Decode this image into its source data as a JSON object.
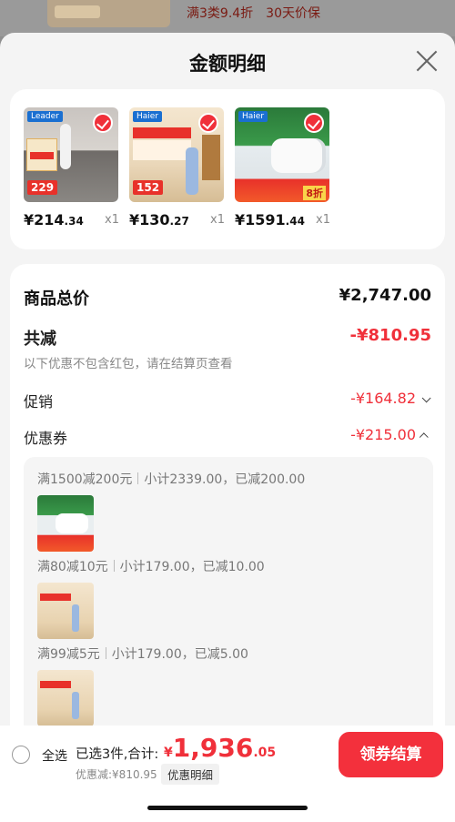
{
  "background": {
    "promo": [
      "满3类9.4折",
      "30天价保"
    ]
  },
  "sheet": {
    "title": "金额明细"
  },
  "products": [
    {
      "brand": "Leader",
      "tag": "229",
      "price_int": "¥214",
      "price_dec": ".34",
      "qty": "x1"
    },
    {
      "brand": "Haier",
      "tag": "152",
      "price_int": "¥130",
      "price_dec": ".27",
      "qty": "x1"
    },
    {
      "brand": "Haier",
      "tag": "8折",
      "price_int": "¥1591",
      "price_dec": ".44",
      "qty": "x1"
    }
  ],
  "summary": {
    "total_label": "商品总价",
    "total_value": "¥2,747.00",
    "minus_label": "共减",
    "minus_value": "-¥810.95",
    "note": "以下优惠不包含红包，请在结算页查看",
    "promo_label": "促销",
    "promo_value": "-¥164.82",
    "coupon_label": "优惠券",
    "coupon_value": "-¥215.00"
  },
  "coupons": [
    {
      "rule": "满1500减200元",
      "detail": "小计2339.00，已减200.00"
    },
    {
      "rule": "满80减10元",
      "detail": "小计179.00，已减10.00"
    },
    {
      "rule": "满99减5元",
      "detail": "小计179.00，已减5.00"
    }
  ],
  "bottom": {
    "select_all": "全选",
    "selected": "已选3件,合计:",
    "currency": "¥",
    "price_int": "1,936",
    "price_dec": ".05",
    "saved": "优惠减:¥810.95",
    "detail": "优惠明细",
    "checkout": "领券结算"
  },
  "colors": {
    "accent": "#f0303a",
    "checkout": "#f3303c"
  }
}
